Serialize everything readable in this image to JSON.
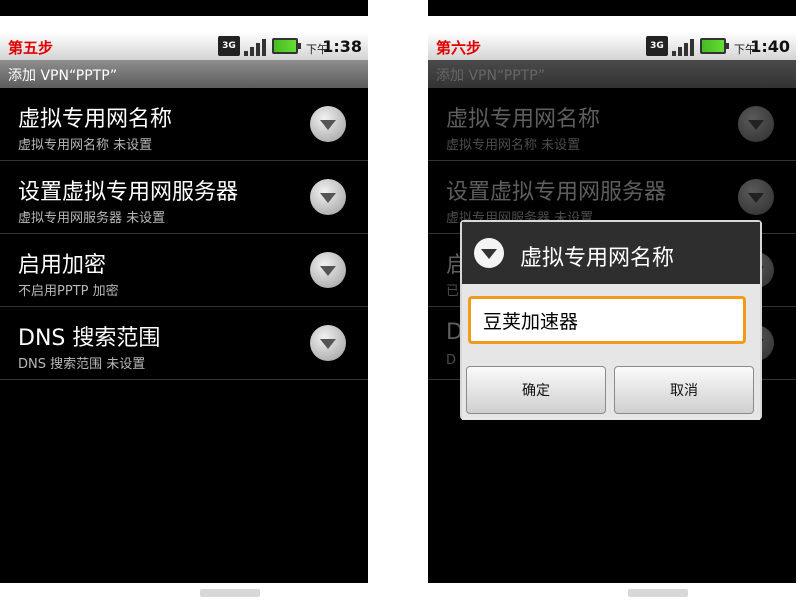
{
  "left": {
    "step": "第五步",
    "network_badge": "3G",
    "time_ampm": "下午",
    "time": "1:38",
    "title": "添加 VPN“PPTP”",
    "items": [
      {
        "title": "虚拟专用网名称",
        "subtitle": "虚拟专用网名称 未设置"
      },
      {
        "title": "设置虚拟专用网服务器",
        "subtitle": "虚拟专用网服务器 未设置"
      },
      {
        "title": "启用加密",
        "subtitle": "不启用PPTP 加密"
      },
      {
        "title": "DNS 搜索范围",
        "subtitle": "DNS 搜索范围 未设置"
      }
    ]
  },
  "right": {
    "step": "第六步",
    "network_badge": "3G",
    "time_ampm": "下午",
    "time": "1:40",
    "title": "添加 VPN“PPTP”",
    "items": [
      {
        "title": "虚拟专用网名称",
        "subtitle": "虚拟专用网名称 未设置"
      },
      {
        "title": "设置虚拟专用网服务器",
        "subtitle": "虚拟专用网服务器 未设置"
      },
      {
        "title": "启",
        "subtitle": "已"
      },
      {
        "title": "D",
        "subtitle": "D"
      }
    ],
    "dialog": {
      "title": "虚拟专用网名称",
      "input_value": "豆荚加速器",
      "ok_label": "确定",
      "cancel_label": "取消"
    }
  },
  "colors": {
    "step_label": "#e00000",
    "input_focus_border": "#f29a1a",
    "battery": "#66dd33"
  },
  "icons": [
    "3g-icon",
    "signal-icon",
    "battery-icon",
    "dropdown-icon"
  ]
}
